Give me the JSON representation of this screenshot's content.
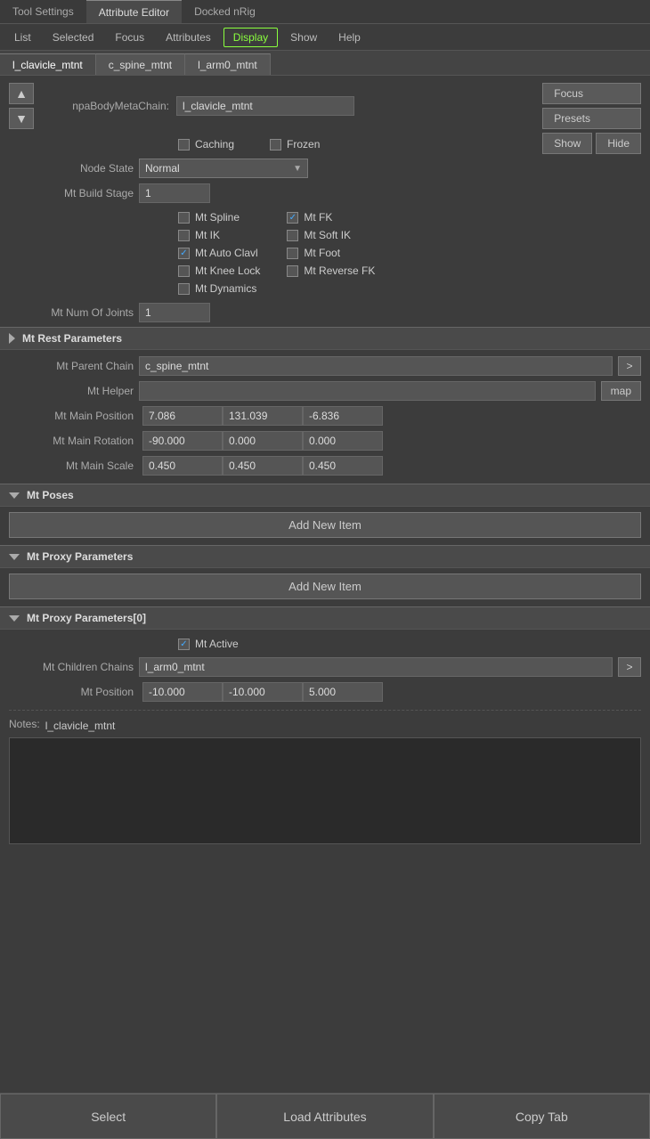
{
  "topTabs": {
    "toolSettings": "Tool Settings",
    "attributeEditor": "Attribute Editor",
    "dockedNRig": "Docked nRig"
  },
  "menuBar": {
    "items": [
      "List",
      "Selected",
      "Focus",
      "Attributes",
      "Display",
      "Show",
      "Help"
    ],
    "activeItem": "Display"
  },
  "fileTabs": [
    {
      "label": "l_clavicle_mtnt",
      "active": true
    },
    {
      "label": "c_spine_mtnt",
      "active": false
    },
    {
      "label": "l_arm0_mtnt",
      "active": false
    }
  ],
  "actionButtons": {
    "focus": "Focus",
    "presets": "Presets",
    "show": "Show",
    "hide": "Hide"
  },
  "fields": {
    "npaBodyMetaChainLabel": "npaBodyMetaChain:",
    "npaBodyMetaChainValue": "l_clavicle_mtnt",
    "cachingLabel": "Caching",
    "frozenLabel": "Frozen",
    "nodeStateLabel": "Node State",
    "nodeStateValue": "Normal",
    "mtBuildStageLabel": "Mt Build Stage",
    "mtBuildStageValue": "1"
  },
  "checkboxes": {
    "left": [
      {
        "label": "Mt Spline",
        "checked": false
      },
      {
        "label": "Mt IK",
        "checked": false
      },
      {
        "label": "Mt Auto Clavl",
        "checked": true
      },
      {
        "label": "Mt Knee Lock",
        "checked": false
      },
      {
        "label": "Mt Dynamics",
        "checked": false
      }
    ],
    "right": [
      {
        "label": "Mt FK",
        "checked": true
      },
      {
        "label": "Mt Soft IK",
        "checked": false
      },
      {
        "label": "Mt Foot",
        "checked": false
      },
      {
        "label": "Mt Reverse FK",
        "checked": false
      }
    ]
  },
  "mtNumOfJoints": {
    "label": "Mt Num Of Joints",
    "value": "1"
  },
  "sections": {
    "restParameters": "Mt Rest Parameters",
    "poses": "Mt Poses",
    "proxyParameters": "Mt Proxy Parameters",
    "proxyParameters0": "Mt Proxy Parameters[0]"
  },
  "restParams": {
    "parentChainLabel": "Mt Parent Chain",
    "parentChainValue": "c_spine_mtnt",
    "helperLabel": "Mt Helper",
    "mainPositionLabel": "Mt Main Position",
    "mainPosition": [
      "7.086",
      "131.039",
      "-6.836"
    ],
    "mainRotationLabel": "Mt Main Rotation",
    "mainRotation": [
      "-90.000",
      "0.000",
      "0.000"
    ],
    "mainScaleLabel": "Mt Main Scale",
    "mainScale": [
      "0.450",
      "0.450",
      "0.450"
    ]
  },
  "proxyParams0": {
    "activeLabel": "Mt Active",
    "activeChecked": true,
    "childrenChainsLabel": "Mt Children Chains",
    "childrenChainsValue": "l_arm0_mtnt",
    "positionLabel": "Mt Position",
    "position": [
      "-10.000",
      "-10.000",
      "5.000"
    ]
  },
  "addNewItem": "Add New Item",
  "notes": {
    "label": "Notes:",
    "subjectLabel": "l_clavicle_mtnt",
    "placeholder": ""
  },
  "bottomButtons": {
    "select": "Select",
    "loadAttributes": "Load Attributes",
    "copyTab": "Copy Tab"
  }
}
